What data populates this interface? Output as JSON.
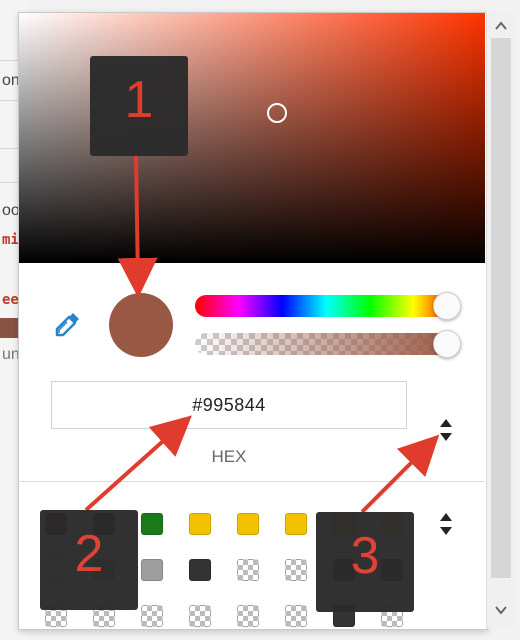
{
  "background_page": {
    "fragments": [
      "on",
      "oo",
      "mi",
      "ee",
      "un"
    ]
  },
  "picker": {
    "eyedropper_icon": "eyedropper-icon",
    "current_color": "#995844",
    "hex_value": "#995844",
    "mode_label": "HEX",
    "mode_toggle_icon": "up-down-arrows-icon",
    "swatches_toggle_icon": "up-down-arrows-icon",
    "swatch_colors": [
      "#4a0000",
      "#0b2a4a",
      "#1a7a1a",
      "#f2c200",
      "#f2c200",
      "#f2c200",
      "#f2c200",
      "#f2c200"
    ],
    "swatch_row2": [
      "#eeeeee",
      "#9e9e9e",
      "#9e9e9e",
      "#333333",
      "checker",
      "checker",
      "#333333",
      "#333333"
    ],
    "swatch_row3": [
      "checker",
      "checker",
      "checker",
      "checker",
      "checker",
      "checker",
      "#333333",
      "checker"
    ]
  },
  "scrollbar": {
    "up_icon": "up-arrow-icon",
    "down_icon": "down-arrow-icon"
  },
  "annotations": {
    "callout_1": "1",
    "callout_2": "2",
    "callout_3": "3",
    "color": "#e03c2e"
  }
}
